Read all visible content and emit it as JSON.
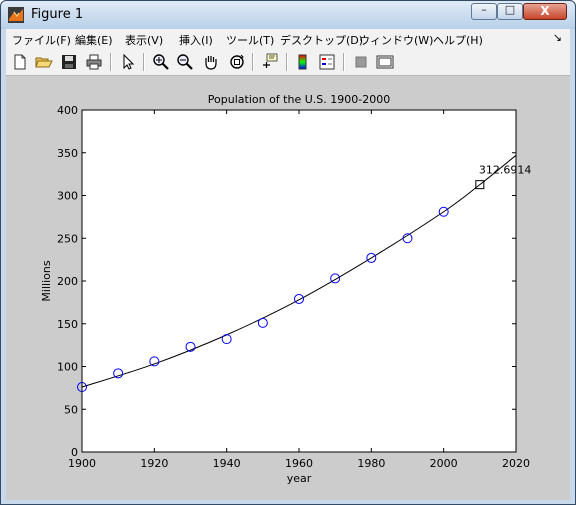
{
  "window": {
    "title": "Figure 1"
  },
  "window_buttons": {
    "minimize": "–",
    "maximize": "□",
    "close": "X"
  },
  "menu": [
    "ファイル(F)",
    "編集(E)",
    "表示(V)",
    "挿入(I)",
    "ツール(T)",
    "デスクトップ(D)",
    "ウィンドウ(W)",
    "ヘルプ(H)"
  ],
  "menu_dock_glyph": "↘",
  "toolbar": {
    "icons": [
      "new-figure-icon",
      "open-file-icon",
      "save-icon",
      "print-icon",
      "pointer-icon",
      "zoom-in-icon",
      "zoom-out-icon",
      "pan-icon",
      "rotate-3d-icon",
      "data-cursor-icon",
      "colorbar-icon",
      "legend-icon",
      "hide-plot-tools-icon",
      "show-plot-tools-icon"
    ]
  },
  "chart_data": {
    "type": "scatter",
    "title": "Population of the U.S. 1900-2000",
    "xlabel": "year",
    "ylabel": "Millions",
    "xlim": [
      1900,
      2020
    ],
    "ylim": [
      0,
      400
    ],
    "xticks": [
      1900,
      1920,
      1940,
      1960,
      1980,
      2000,
      2020
    ],
    "yticks": [
      0,
      50,
      100,
      150,
      200,
      250,
      300,
      350,
      400
    ],
    "grid": false,
    "series": [
      {
        "marker": "circle",
        "color": "#0000ff",
        "x": [
          1900,
          1910,
          1920,
          1930,
          1940,
          1950,
          1960,
          1970,
          1980,
          1990,
          2000
        ],
        "y": [
          76,
          92,
          106,
          123,
          132,
          151,
          179,
          203,
          227,
          250,
          281
        ]
      }
    ],
    "fit_curve": {
      "color": "#000000",
      "x": [
        1900,
        1920,
        1940,
        1960,
        1980,
        2000,
        2010,
        2020
      ],
      "y": [
        76,
        103,
        137,
        178,
        227,
        281,
        312.7,
        347
      ]
    },
    "prediction": {
      "x": 2010,
      "y": 312.6914,
      "label": "312.6914",
      "marker": "square"
    }
  }
}
